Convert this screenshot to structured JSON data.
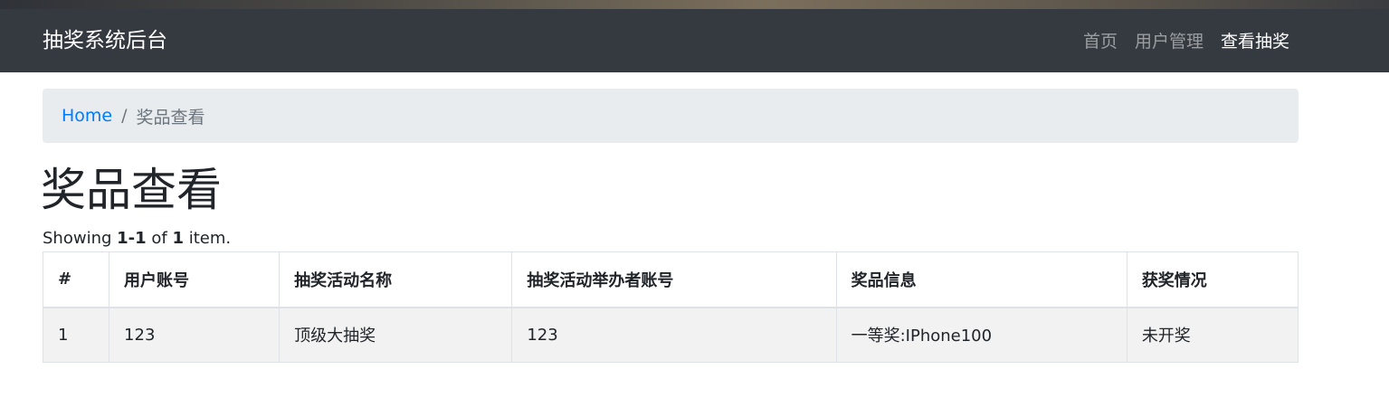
{
  "navbar": {
    "brand": "抽奖系统后台",
    "links": [
      {
        "label": "首页",
        "active": false
      },
      {
        "label": "用户管理",
        "active": false
      },
      {
        "label": "查看抽奖",
        "active": true
      }
    ]
  },
  "breadcrumb": {
    "home": "Home",
    "separator": "/",
    "current": "奖品查看"
  },
  "page": {
    "title": "奖品查看"
  },
  "summary": {
    "prefix": "Showing ",
    "range": "1-1",
    "middle": " of ",
    "total": "1",
    "suffix": " item."
  },
  "table": {
    "columns": [
      "#",
      "用户账号",
      "抽奖活动名称",
      "抽奖活动举办者账号",
      "奖品信息",
      "获奖情况"
    ],
    "rows": [
      [
        "1",
        "123",
        "顶级大抽奖",
        "123",
        "一等奖:IPhone100",
        "未开奖"
      ]
    ]
  }
}
